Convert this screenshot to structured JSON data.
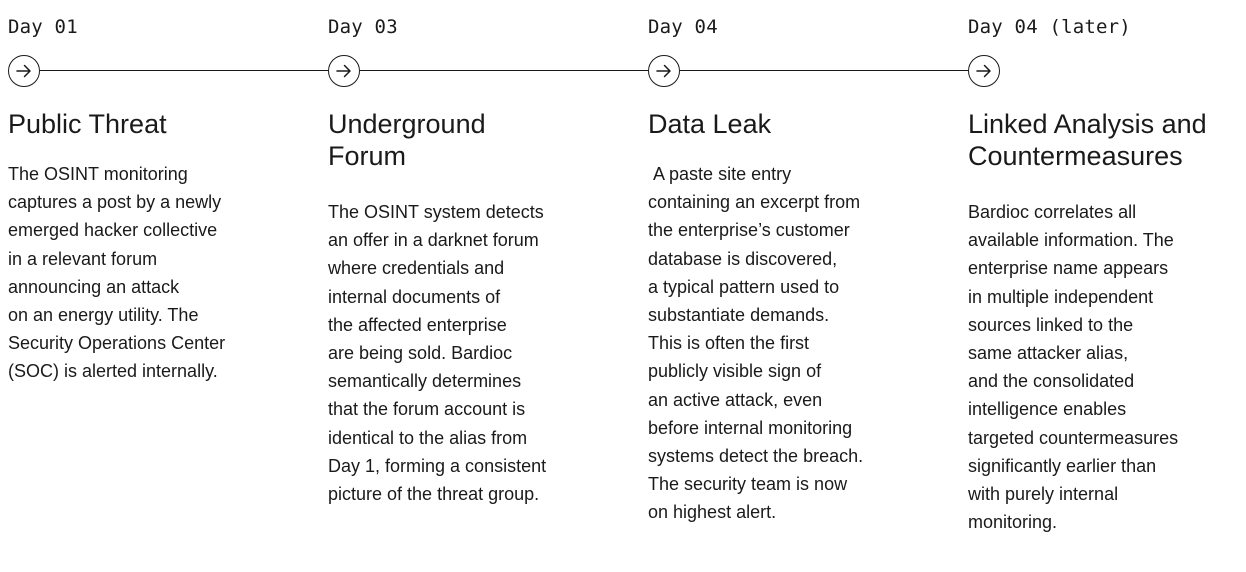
{
  "timeline": {
    "steps": [
      {
        "day": "Day 01",
        "title": "Public Threat",
        "description": "The OSINT monitoring\ncaptures a post by a newly\nemerged hacker collective\nin a relevant forum\nannouncing an attack\non an energy utility. The\nSecurity Operations Center\n(SOC) is alerted internally."
      },
      {
        "day": "Day 03",
        "title": "Underground\nForum",
        "description": "The OSINT system detects\nan offer in a darknet forum\nwhere credentials and\ninternal documents of\nthe affected enterprise\nare being sold. Bardioc\nsemantically determines\nthat the forum account is\nidentical to the alias from\nDay 1, forming a consistent\npicture of the threat group."
      },
      {
        "day": "Day 04",
        "title": "Data Leak",
        "description": " A paste site entry\ncontaining an excerpt from\nthe enterprise’s customer\ndatabase is discovered,\na typical pattern used to\nsubstantiate demands.\nThis is often the first\npublicly visible sign of\nan active attack, even\nbefore internal monitoring\nsystems detect the breach.\nThe security team is now\non highest alert."
      },
      {
        "day": "Day 04 (later)",
        "title": "Linked Analysis and\nCountermeasures",
        "description": "Bardioc correlates all\navailable information. The\nenterprise name appears\nin multiple independent\nsources linked to the\nsame attacker alias,\nand the consolidated\nintelligence enables\ntargeted countermeasures\nsignificantly earlier than\nwith purely internal\nmonitoring."
      }
    ]
  },
  "icons": {
    "marker": "arrow-right-icon"
  },
  "colors": {
    "text": "#1a1a1a",
    "background": "#ffffff"
  }
}
